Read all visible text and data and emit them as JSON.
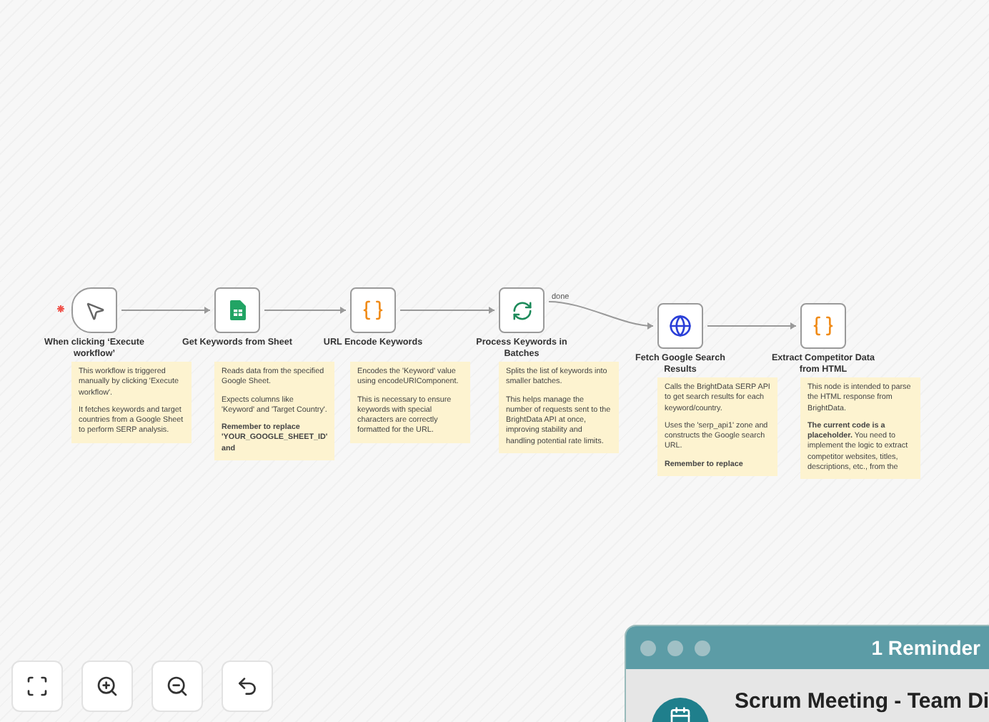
{
  "nodes": [
    {
      "kind": "trigger",
      "title": "When clicking ‘Execute workflow’",
      "note": [
        "This workflow is triggered manually by clicking 'Execute workflow'.",
        "It fetches keywords and target countries from a Google Sheet to perform SERP analysis."
      ]
    },
    {
      "kind": "sheet",
      "title": "Get Keywords from Sheet",
      "note": [
        "Reads data from the specified Google Sheet.",
        "Expects columns like 'Keyword' and 'Target Country'.",
        "**Remember to replace 'YOUR_GOOGLE_SHEET_ID' and**"
      ]
    },
    {
      "kind": "code",
      "title": "URL Encode Keywords",
      "note": [
        "Encodes the 'Keyword' value using encodeURIComponent.",
        "This is necessary to ensure keywords with special characters are correctly formatted for the URL."
      ]
    },
    {
      "kind": "batch",
      "title": "Process Keywords in Batches",
      "note": [
        "Splits the list of keywords into smaller batches.",
        "This helps manage the number of requests sent to the BrightData API at once, improving stability and handling potential rate limits."
      ]
    },
    {
      "kind": "http",
      "title": "Fetch Google Search Results",
      "note": [
        "Calls the BrightData SERP API to get search results for each keyword/country.",
        "Uses the 'serp_api1' zone and constructs the Google search URL.",
        "**Remember to replace**"
      ]
    },
    {
      "kind": "code",
      "title": "Extract Competitor Data from HTML",
      "note": [
        "This node is intended to parse the HTML response from BrightData.",
        "**The current code is a placeholder.** You need to implement the logic to extract competitor websites, titles, descriptions, etc., from the"
      ]
    }
  ],
  "edge_label": "done",
  "reminder": {
    "title": "1 Reminder",
    "event": "Scrum Meeting - Team Di"
  }
}
